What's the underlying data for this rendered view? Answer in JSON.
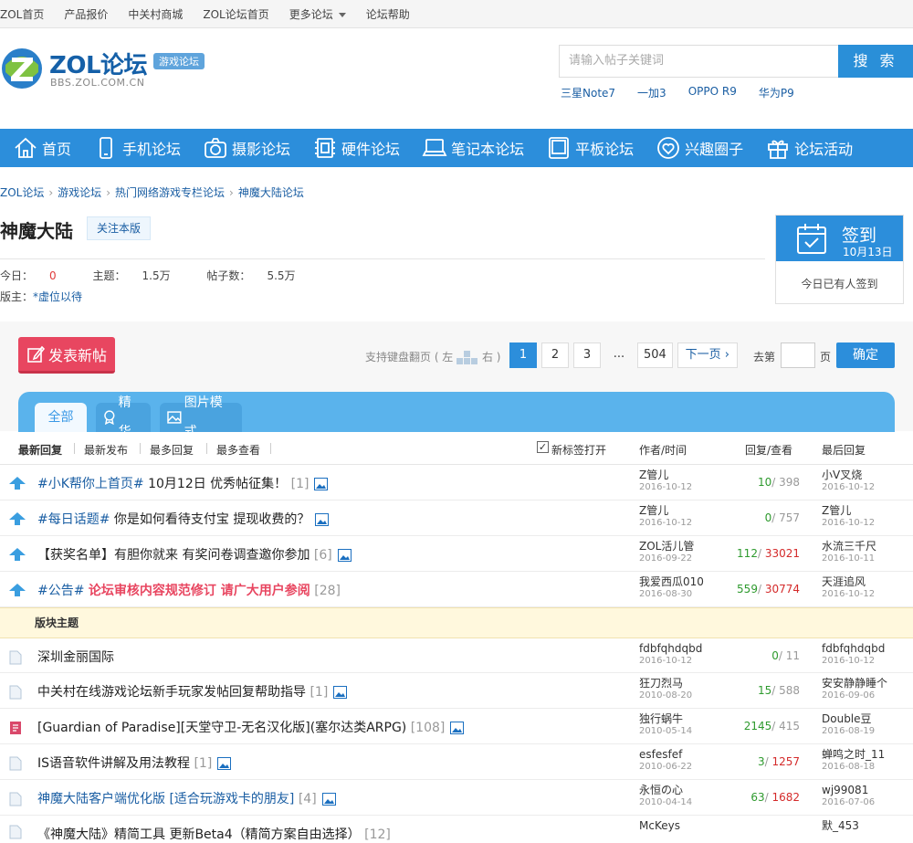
{
  "topbar": {
    "items": [
      "ZOL首页",
      "产品报价",
      "中关村商城",
      "ZOL论坛首页",
      "更多论坛",
      "论坛帮助"
    ]
  },
  "header": {
    "logo_text": "ZOL论坛",
    "logo_sub": "BBS.ZOL.COM.CN",
    "logo_tag": "游戏论坛",
    "search_placeholder": "请输入帖子关键词",
    "search_button": "搜 索",
    "hotwords": [
      "三星Note7",
      "一加3",
      "OPPO R9",
      "华为P9"
    ]
  },
  "nav": [
    {
      "label": "首页",
      "icon": "home-icon"
    },
    {
      "label": "手机论坛",
      "icon": "phone-icon"
    },
    {
      "label": "摄影论坛",
      "icon": "camera-icon"
    },
    {
      "label": "硬件论坛",
      "icon": "chip-icon"
    },
    {
      "label": "笔记本论坛",
      "icon": "laptop-icon"
    },
    {
      "label": "平板论坛",
      "icon": "tablet-icon"
    },
    {
      "label": "兴趣圈子",
      "icon": "heart-icon"
    },
    {
      "label": "论坛活动",
      "icon": "gift-icon"
    }
  ],
  "breadcrumb": [
    "ZOL论坛",
    "游戏论坛",
    "热门网络游戏专栏论坛",
    "神魔大陆论坛"
  ],
  "forum": {
    "title": "神魔大陆",
    "follow": "关注本版",
    "today_label": "今日：",
    "today_value": "0",
    "topics_label": "主题：",
    "topics_value": "1.5万",
    "posts_label": "帖子数：",
    "posts_value": "5.5万",
    "mods_label": "版主：",
    "mods_value": "*虚位以待"
  },
  "signin": {
    "label": "签到",
    "date": "10月13日",
    "note": "今日已有人签到"
  },
  "actions": {
    "post_button": "发表新帖",
    "kb_hint_left": "支持键盘翻页 ( 左",
    "kb_hint_right": "右 )",
    "pages": [
      "1",
      "2",
      "3",
      "...",
      "504"
    ],
    "next": "下一页",
    "goto_label": "去第",
    "goto_unit": "页",
    "goto_button": "确定"
  },
  "tabs": [
    "全部",
    "精华",
    "图片模式"
  ],
  "sort": {
    "options": [
      "最新回复",
      "最新发布",
      "最多回复",
      "最多查看"
    ],
    "newtab": "新标签打开",
    "col_author": "作者/时间",
    "col_reply": "回复/查看",
    "col_last": "最后回复"
  },
  "sticky": [
    {
      "tag": "#小K帮你上首页#",
      "title": " 10月12日 优秀帖征集！",
      "count": "[1]",
      "author": "Z管儿",
      "date": "2016-10-12",
      "replies": "10",
      "views": "398",
      "last": "小V叉烧",
      "last_date": "2016-10-12"
    },
    {
      "tag": "#每日话题#",
      "title": " 你是如何看待支付宝 提现收费的？",
      "count": "",
      "author": "Z管儿",
      "date": "2016-10-12",
      "replies": "0",
      "views": "757",
      "last": "Z管儿",
      "last_date": "2016-10-12"
    },
    {
      "tag": "",
      "title": "【获奖名单】有胆你就来 有奖问卷调查邀你参加",
      "count": "[6]",
      "author": "ZOL活儿管",
      "date": "2016-09-22",
      "replies": "112",
      "views": "33021",
      "last": "水流三千尺",
      "last_date": "2016-10-11"
    },
    {
      "tag": "#公告#",
      "title": "论坛审核内容规范修订 请广大用户参阅",
      "count": "[28]",
      "author": "我爱西瓜010",
      "date": "2016-08-30",
      "replies": "559",
      "views": "30774",
      "last": "天涯追风",
      "last_date": "2016-10-12"
    }
  ],
  "section_label": "版块主题",
  "threads": [
    {
      "title": "深圳金丽国际",
      "count": "",
      "author": "fdbfqhdqbd",
      "date": "2016-10-12",
      "replies": "0",
      "views": "11",
      "last": "fdbfqhdqbd",
      "last_date": "2016-10-12"
    },
    {
      "title": "中关村在线游戏论坛新手玩家发帖回复帮助指导",
      "count": "[1]",
      "author": "狂刀烈马",
      "date": "2010-08-20",
      "replies": "15",
      "views": "588",
      "last": "安安静静睡个",
      "last_date": "2016-09-06"
    },
    {
      "title": "[Guardian of Paradise][天堂守卫-无名汉化版](塞尔达类ARPG)",
      "count": "[108]",
      "author": "独行蜗牛",
      "date": "2010-05-14",
      "replies": "2145",
      "views": "415",
      "last": "Double豆",
      "last_date": "2016-08-19"
    },
    {
      "title": "IS语音软件讲解及用法教程",
      "count": "[1]",
      "author": "esfesfef",
      "date": "2010-06-22",
      "replies": "3",
      "views": "1257",
      "last": "蝉鸣之时_11",
      "last_date": "2016-08-18"
    },
    {
      "title": "神魔大陆客户端优化版 [适合玩游戏卡的朋友]",
      "count": "[4]",
      "author": "永恒の心",
      "date": "2010-04-14",
      "replies": "63",
      "views": "1682",
      "last": "wj99081",
      "last_date": "2016-07-06"
    },
    {
      "title": "《神魔大陆》精简工具 更新Beta4（精简方案自由选择）",
      "count": "[12]",
      "author": "McKeys",
      "date": "",
      "replies": "",
      "views": "",
      "last": "默_453",
      "last_date": ""
    }
  ]
}
